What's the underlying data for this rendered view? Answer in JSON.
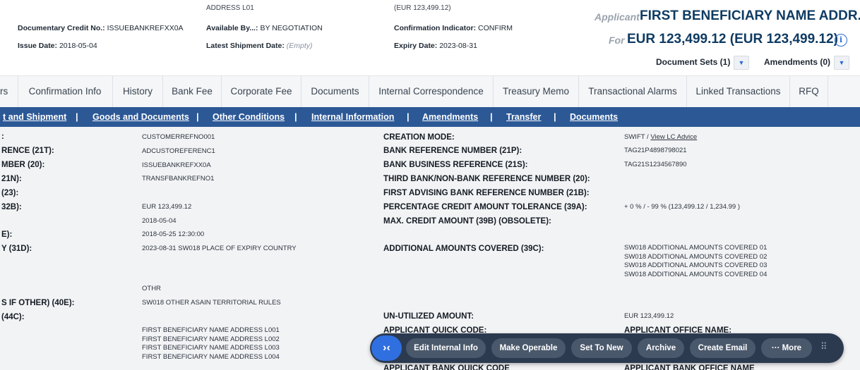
{
  "header": {
    "cut_top_left": "ADDRESS L01",
    "cut_top_right": "(EUR 123,499.12)",
    "doc_credit_label": "Documentary Credit No.:",
    "doc_credit_value": "ISSUEBANKREFXX0A",
    "issue_date_label": "Issue Date:",
    "issue_date_value": "2018-05-04",
    "available_by_label": "Available By...:",
    "available_by_value": "BY NEGOTIATION",
    "latest_shipment_label": "Latest Shipment Date:",
    "latest_shipment_value": "(Empty)",
    "confirmation_label": "Confirmation Indicator:",
    "confirmation_value": "CONFIRM",
    "expiry_label": "Expiry Date:",
    "expiry_value": "2023-08-31",
    "applicant_label": "Applicant",
    "applicant_name": "FIRST BENEFICIARY NAME ADDR...",
    "for_label": "For",
    "amount": "EUR 123,499.12 (EUR 123,499.12)",
    "info_icon": "i",
    "document_sets": "Document Sets (1)",
    "amendments": "Amendments (0)",
    "dropdown_icon": "▼"
  },
  "tabs": [
    "rs",
    "Confirmation Info",
    "History",
    "Bank Fee",
    "Corporate Fee",
    "Documents",
    "Internal Correspondence",
    "Treasury Memo",
    "Transactional Alarms",
    "Linked Transactions",
    "RFQ"
  ],
  "subnav": {
    "links": [
      "t and Shipment",
      "Goods and Documents",
      "Other Conditions",
      "Internal Information",
      "Amendments",
      "Transfer",
      "Documents"
    ],
    "separator": "|"
  },
  "left_fields": [
    {
      "label": ":",
      "value": "CUSTOMERREFNO001"
    },
    {
      "label": "RENCE (21T):",
      "value": "ADCUSTOREFERENC1"
    },
    {
      "label": "MBER (20):",
      "value": "ISSUEBANKREFXX0A"
    },
    {
      "label": "21N):",
      "value": "TRANSFBANKREFNO1"
    },
    {
      "label": "(23):",
      "value": ""
    },
    {
      "label": "32B):",
      "value": "EUR 123,499.12"
    },
    {
      "label": "",
      "value": "2018-05-04"
    },
    {
      "label": "E):",
      "value": "2018-05-25 12:30:00"
    },
    {
      "label": "Y (31D):",
      "value": "2023-08-31  SW018 PLACE OF EXPIRY COUNTRY"
    },
    {
      "label": "",
      "value": "OTHR"
    },
    {
      "label": "S IF OTHER) (40E):",
      "value": "SW018 OTHER ASAIN TERRITORIAL RULES"
    },
    {
      "label": "(44C):",
      "value": ""
    }
  ],
  "beneficiary_lines": [
    "FIRST BENEFICIARY NAME ADDRESS L001",
    "FIRST BENEFICIARY NAME ADDRESS L002",
    "FIRST BENEFICIARY NAME ADDRESS L003",
    "FIRST BENEFICIARY NAME ADDRESS L004"
  ],
  "right_fields": [
    {
      "label": "CREATION MODE:",
      "value": "SWIFT",
      "link": "View LC Advice"
    },
    {
      "label": "BANK REFERENCE NUMBER (21P):",
      "value": "TAG21P4898798021"
    },
    {
      "label": "BANK BUSINESS REFERENCE (21S):",
      "value": "TAG21S1234567890"
    },
    {
      "label": "THIRD BANK/NON-BANK REFERENCE NUMBER (20):",
      "value": ""
    },
    {
      "label": "FIRST ADVISING BANK REFERENCE NUMBER (21B):",
      "value": ""
    },
    {
      "label": "PERCENTAGE CREDIT AMOUNT TOLERANCE (39A):",
      "value": "+ 0 % / - 99 % (123,499.12 / 1,234.99 )"
    },
    {
      "label": "MAX. CREDIT AMOUNT (39B) (OBSOLETE):",
      "value": ""
    },
    {
      "label": "ADDITIONAL AMOUNTS COVERED (39C):",
      "value": ""
    },
    {
      "label": "UN-UTILIZED AMOUNT:",
      "value": "EUR 123,499.12"
    },
    {
      "label": "APPLICANT QUICK CODE:",
      "value": "APPLICANT OFFICE NAME:"
    },
    {
      "label": "APPLICANT BANK QUICK CODE",
      "value": "APPLICANT BANK OFFICE NAME"
    }
  ],
  "additional_amounts": [
    "SW018 ADDITIONAL AMOUNTS COVERED 01",
    "SW018 ADDITIONAL AMOUNTS COVERED 02",
    "SW018 ADDITIONAL AMOUNTS COVERED 03",
    "SW018 ADDITIONAL AMOUNTS COVERED 04"
  ],
  "action_bar": {
    "collapse_icon": "›‹",
    "buttons": [
      "Edit Internal Info",
      "Make Operable",
      "Set To New",
      "Archive",
      "Create Email",
      "··· More"
    ],
    "grip_icon": "⠿"
  }
}
